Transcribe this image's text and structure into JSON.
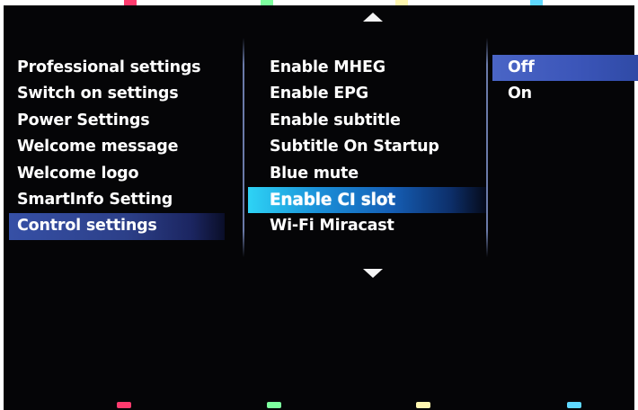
{
  "menu_left": {
    "items": [
      {
        "label": "Professional settings"
      },
      {
        "label": "Switch on settings"
      },
      {
        "label": "Power Settings"
      },
      {
        "label": "Welcome message"
      },
      {
        "label": "Welcome logo"
      },
      {
        "label": "SmartInfo Setting"
      },
      {
        "label": "Control settings",
        "selected": true
      }
    ]
  },
  "menu_middle": {
    "items": [
      {
        "label": "Enable MHEG"
      },
      {
        "label": "Enable EPG"
      },
      {
        "label": "Enable subtitle"
      },
      {
        "label": "Subtitle On Startup"
      },
      {
        "label": "Blue mute"
      },
      {
        "label": "Enable CI slot",
        "focused": true
      },
      {
        "label": "Wi-Fi Miracast"
      }
    ]
  },
  "menu_right": {
    "items": [
      {
        "label": "Off",
        "selected": true
      },
      {
        "label": "On"
      }
    ]
  },
  "icons": {
    "scroll_up": "triangle-up-icon",
    "scroll_down": "triangle-down-icon"
  },
  "color_keys": {
    "red": "#ff3b6e",
    "green": "#7dff9e",
    "yellow": "#fff7b0",
    "blue": "#5fd8ff"
  }
}
